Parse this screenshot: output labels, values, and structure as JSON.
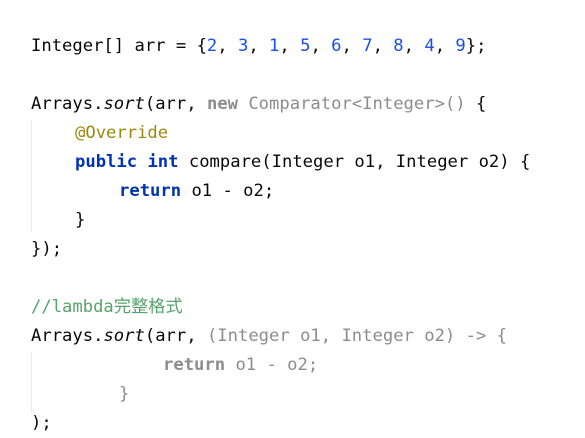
{
  "code": {
    "line1": {
      "type": "Integer[] arr = {",
      "n1": "2",
      "n2": "3",
      "n3": "1",
      "n4": "5",
      "n5": "6",
      "n6": "7",
      "n7": "8",
      "n8": "4",
      "n9": "9",
      "sep": ", ",
      "end": "};"
    },
    "line2": {
      "cls": "Arrays.",
      "method": "sort",
      "args": "(arr, ",
      "new_kw": "new",
      "anon": " Comparator<Integer>()",
      "brace": " {"
    },
    "line3": {
      "annotation": "@Override"
    },
    "line4": {
      "public_kw": "public",
      "int_kw": "int",
      "sig": " compare(Integer o1, Integer o2) {"
    },
    "line5": {
      "return_kw": "return",
      "expr": " o1 - o2;"
    },
    "line6": {
      "text": "}"
    },
    "line7": {
      "text": "});"
    },
    "line9": {
      "comment": "//lambda",
      "comment_cjk": "完整格式"
    },
    "line10": {
      "cls": "Arrays.",
      "method": "sort",
      "args": "(arr, ",
      "lambda": "(Integer o1, Integer o2) -> {"
    },
    "line11": {
      "return_kw": "return",
      "expr": " o1 - o2;"
    },
    "line12": {
      "text": "}"
    },
    "line13": {
      "text": ");"
    }
  },
  "colors": {
    "keyword": "#0033b3",
    "number": "#1750eb",
    "annotation": "#9e880d",
    "comment": "#56a36c",
    "dimmed": "#8c8c8c",
    "text": "#080808"
  }
}
